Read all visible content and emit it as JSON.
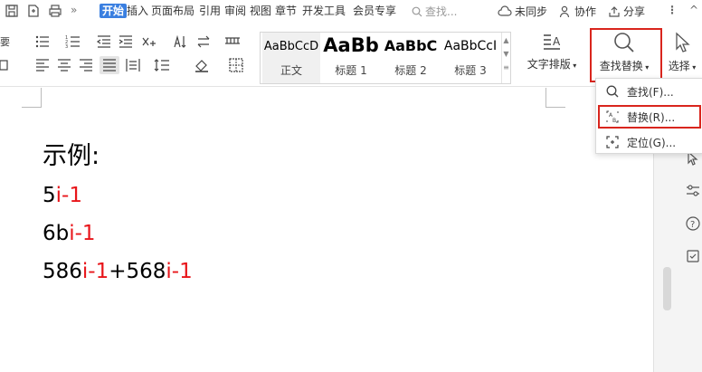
{
  "menubar": {
    "tabs": [
      "开始",
      "插入",
      "页面布局",
      "引用",
      "审阅",
      "视图",
      "章节",
      "开发工具",
      "会员专享"
    ],
    "active_tab": "开始",
    "search_placeholder": "查找...",
    "unsynced": "未同步",
    "collab": "协作",
    "share": "分享",
    "more_icon": "more-vertical-icon"
  },
  "styles": [
    {
      "sample": "AaBbCcD",
      "name": "正文"
    },
    {
      "sample": "AaBb",
      "name": "标题 1"
    },
    {
      "sample": "AaBbC",
      "name": "标题 2"
    },
    {
      "sample": "AaBbCcI",
      "name": "标题 3"
    }
  ],
  "ribbon": {
    "text_layout": "文字排版",
    "find_replace": "查找替换",
    "select": "选择"
  },
  "dropdown": {
    "items": [
      {
        "label": "查找(F)...",
        "icon": "search-icon"
      },
      {
        "label": "替换(R)...",
        "icon": "replace-icon"
      },
      {
        "label": "定位(G)...",
        "icon": "locate-icon"
      }
    ]
  },
  "document": {
    "title": "示例:",
    "lines": [
      [
        {
          "t": "5",
          "red": false
        },
        {
          "t": "i-1",
          "red": true
        }
      ],
      [
        {
          "t": "6b",
          "red": false
        },
        {
          "t": "i-1",
          "red": true
        }
      ],
      [
        {
          "t": "586",
          "red": false
        },
        {
          "t": "i-1",
          "red": true
        },
        {
          "t": "+568",
          "red": false
        },
        {
          "t": "i-1",
          "red": true
        }
      ]
    ]
  },
  "colors": {
    "accent": "#3a7fe0",
    "highlight_box": "#d9251d",
    "red_text": "#e8151a"
  }
}
